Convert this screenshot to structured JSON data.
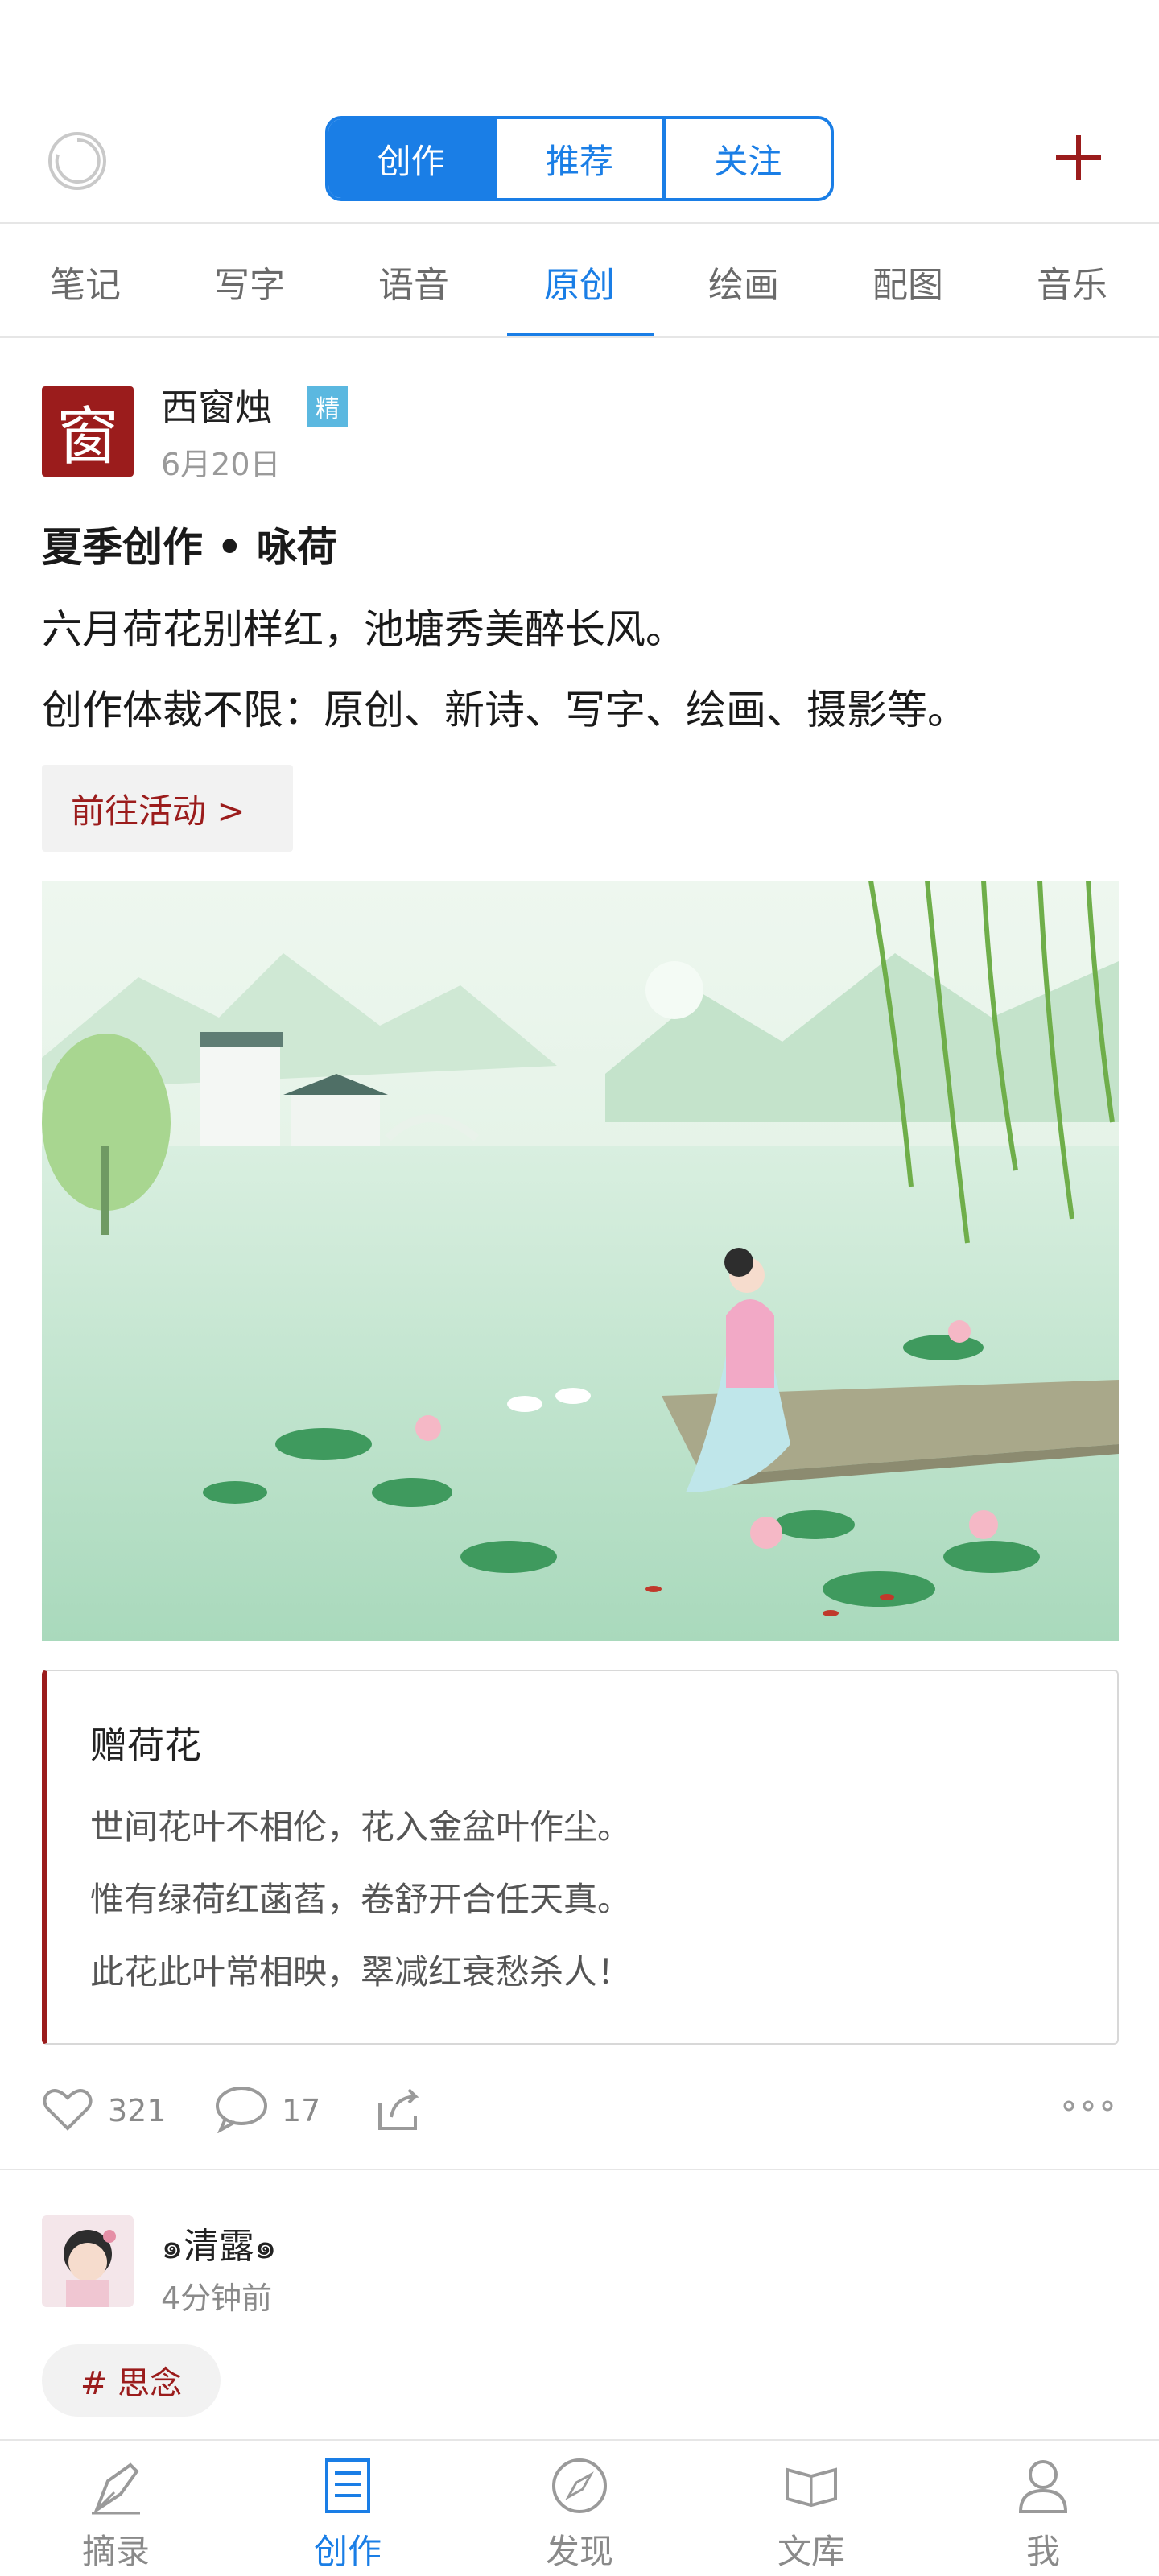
{
  "header": {
    "segments": [
      "创作",
      "推荐",
      "关注"
    ],
    "active_segment": 0
  },
  "categories": [
    "笔记",
    "写字",
    "语音",
    "原创",
    "绘画",
    "配图",
    "音乐"
  ],
  "active_category": 3,
  "post": {
    "avatar_char": "窗",
    "author": "西窗烛",
    "badge": "精",
    "date": "6月20日",
    "title": "夏季创作 • 咏荷",
    "lines": [
      "六月荷花别样红，池塘秀美醉长风。",
      "创作体裁不限：原创、新诗、写字、绘画、摄影等。"
    ],
    "cta": "前往活动 >",
    "poem": {
      "title": "赠荷花",
      "lines": [
        "世间花叶不相伦，花入金盆叶作尘。",
        "惟有绿荷红菡萏，卷舒开合任天真。",
        "此花此叶常相映，翠减红衰愁杀人！"
      ]
    },
    "likes": "321",
    "comments": "17"
  },
  "post2": {
    "author": "๑清露๑",
    "time": "4分钟前",
    "tag": "# 思念"
  },
  "nav": {
    "items": [
      "摘录",
      "创作",
      "发现",
      "文库",
      "我"
    ],
    "active": 1
  },
  "colors": {
    "accent": "#1a7ee6",
    "brand_red": "#9b1c1c"
  }
}
